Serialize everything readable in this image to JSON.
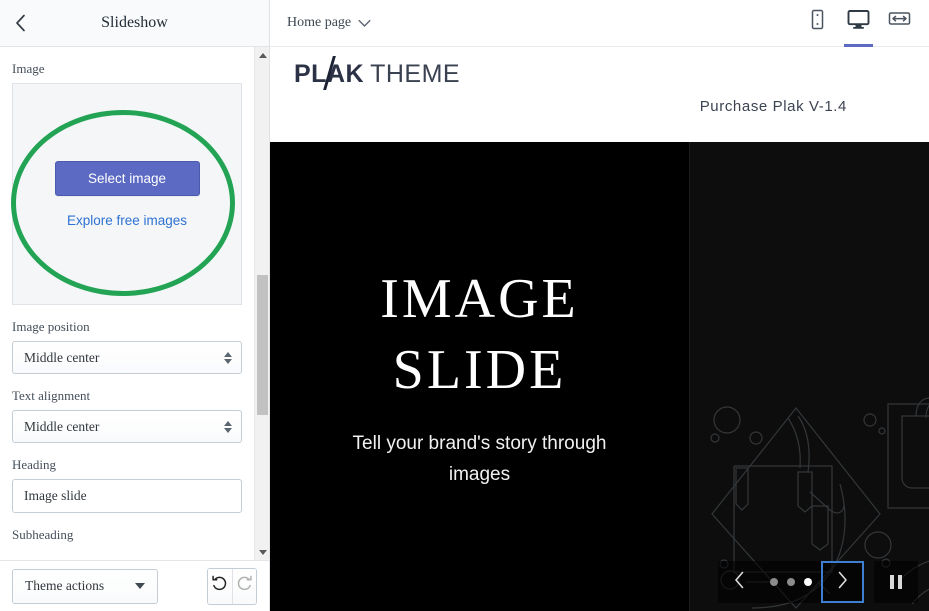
{
  "sidebar": {
    "back_icon": "chevron-left-icon",
    "title": "Slideshow",
    "fields": {
      "image_label": "Image",
      "select_image_button": "Select image",
      "explore_link": "Explore free images",
      "image_position_label": "Image position",
      "image_position_value": "Middle center",
      "text_alignment_label": "Text alignment",
      "text_alignment_value": "Middle center",
      "heading_label": "Heading",
      "heading_value": "Image slide",
      "subheading_label": "Subheading"
    },
    "footer": {
      "theme_actions_label": "Theme actions",
      "undo_icon": "undo-arrow-icon",
      "redo_icon": "redo-arrow-icon"
    },
    "annotation_color": "#23a455",
    "primary_color": "#5c6ac4",
    "link_color": "#2e72d2"
  },
  "preview": {
    "page_selector_label": "Home page",
    "page_selector_icon": "chevron-down-icon",
    "devices": [
      {
        "name": "mobile-view",
        "icon": "mobile-icon",
        "active": false
      },
      {
        "name": "desktop-view",
        "icon": "desktop-icon",
        "active": true
      },
      {
        "name": "fullwidth-view",
        "icon": "fullwidth-icon",
        "active": false
      }
    ],
    "accent_color": "#5c6ac4",
    "site": {
      "logo_part1": "PL",
      "logo_part2": "A",
      "logo_part3": "K",
      "logo_part4": "THEME",
      "purchase_link": "Purchase Plak V-1.4"
    },
    "slide": {
      "heading_line1": "IMAGE",
      "heading_line2": "SLIDE",
      "subheading": "Tell your brand's story through images"
    },
    "controls": {
      "prev_icon": "chevron-left-icon",
      "next_icon": "chevron-right-icon",
      "pause_icon": "pause-icon",
      "dots": [
        {
          "label": "slide-1",
          "active": false
        },
        {
          "label": "slide-2",
          "active": false
        },
        {
          "label": "slide-3",
          "active": true
        }
      ]
    }
  }
}
